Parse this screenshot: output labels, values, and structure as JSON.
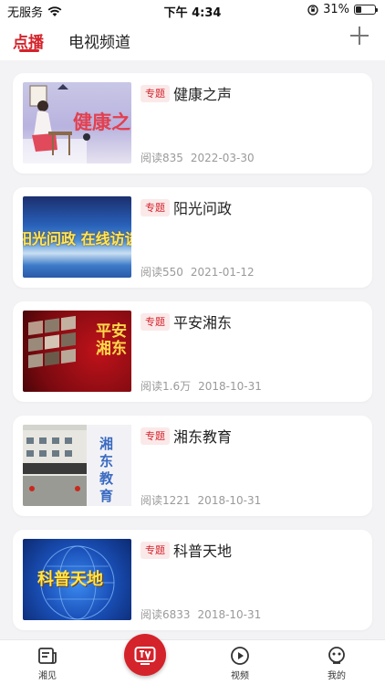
{
  "status": {
    "carrier": "无服务",
    "time": "下午 4:34",
    "battery": "31%",
    "battery_level": 0.31
  },
  "nav": {
    "tab_vod": "点播",
    "tab_tv": "电视频道"
  },
  "items": [
    {
      "tag": "专题",
      "title": "健康之声",
      "reads": "阅读835",
      "date": "2022-03-30",
      "thumb_text": "健康之"
    },
    {
      "tag": "专题",
      "title": "阳光问政",
      "reads": "阅读550",
      "date": "2021-01-12",
      "thumb_text": "阳光问政 在线访谈"
    },
    {
      "tag": "专题",
      "title": "平安湘东",
      "reads": "阅读1.6万",
      "date": "2018-10-31",
      "thumb_text": "平安湘东"
    },
    {
      "tag": "专题",
      "title": "湘东教育",
      "reads": "阅读1221",
      "date": "2018-10-31",
      "thumb_text": "湘东教育"
    },
    {
      "tag": "专题",
      "title": "科普天地",
      "reads": "阅读6833",
      "date": "2018-10-31",
      "thumb_text": "科普天地"
    }
  ],
  "bottom": {
    "tab1": "湘见",
    "tab3": "视频",
    "tab4": "我的"
  }
}
